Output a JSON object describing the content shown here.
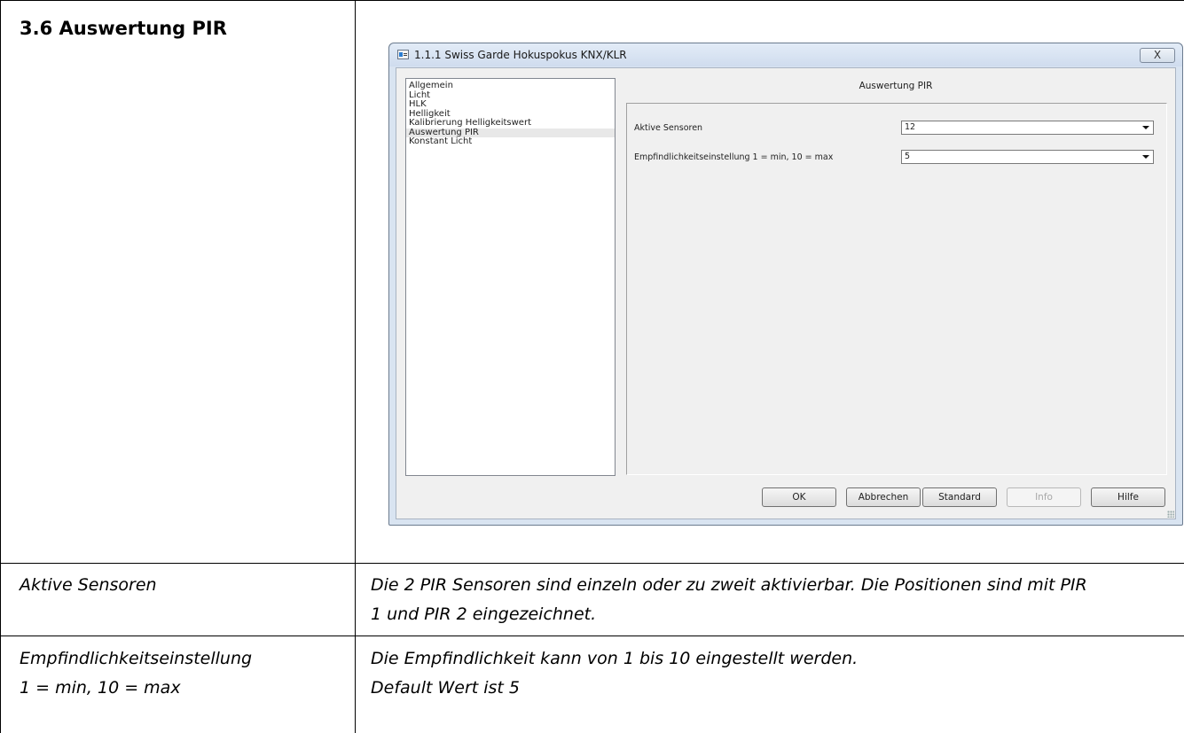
{
  "section": {
    "heading": "3.6  Auswertung PIR"
  },
  "dialog": {
    "title": "1.1.1 Swiss Garde Hokuspokus KNX/KLR",
    "close_label": "X",
    "nav_items": [
      {
        "label": "Allgemein"
      },
      {
        "label": "Licht"
      },
      {
        "label": "HLK"
      },
      {
        "label": "Helligkeit"
      },
      {
        "label": "Kalibrierung Helligkeitswert"
      },
      {
        "label": "Auswertung PIR"
      },
      {
        "label": "Konstant Licht"
      }
    ],
    "selected_nav": "Auswertung PIR",
    "panel_title": "Auswertung PIR",
    "params": [
      {
        "label": "Aktive Sensoren",
        "value": "12"
      },
      {
        "label": "Empfindlichkeitseinstellung 1 = min, 10 = max",
        "value": "5"
      }
    ],
    "buttons": {
      "ok": "OK",
      "cancel": "Abbrechen",
      "standard": "Standard",
      "info": "Info",
      "help": "Hilfe"
    }
  },
  "table_rows": [
    {
      "param_line1": "Aktive Sensoren",
      "param_line2": "",
      "desc_line1": "Die 2 PIR Sensoren sind einzeln oder zu zweit aktivierbar. Die Positionen sind mit PIR",
      "desc_line2": "1 und PIR 2 eingezeichnet."
    },
    {
      "param_line1": "Empfindlichkeitseinstellung",
      "param_line2": "1 = min, 10 = max",
      "desc_line1": "Die Empfindlichkeit kann von 1 bis 10 eingestellt werden.",
      "desc_line2": "Default Wert ist 5"
    }
  ]
}
